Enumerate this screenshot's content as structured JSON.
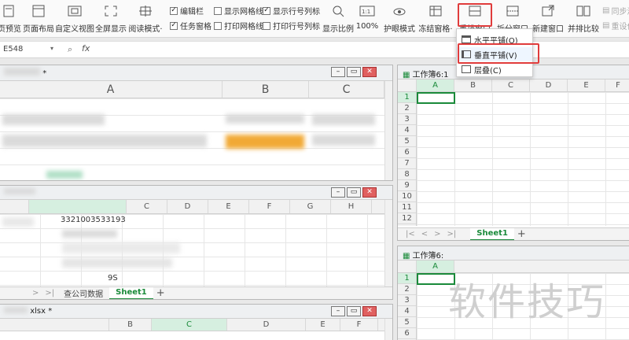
{
  "ribbon": {
    "buttons": [
      {
        "label": "页预览",
        "icon": "page-preview-icon"
      },
      {
        "label": "页面布局",
        "icon": "page-layout-icon"
      },
      {
        "label": "自定义视图",
        "icon": "custom-view-icon"
      },
      {
        "label": "全屏显示",
        "icon": "fullscreen-icon"
      },
      {
        "label": "阅读模式·",
        "icon": "reading-mode-icon"
      },
      {
        "label": "显示比例",
        "icon": "zoom-icon"
      },
      {
        "label": "100%",
        "icon": "zoom-100-icon"
      },
      {
        "label": "护眼模式",
        "icon": "eye-icon"
      },
      {
        "label": "冻结窗格·",
        "icon": "freeze-panes-icon"
      },
      {
        "label": "重排窗口",
        "icon": "arrange-windows-icon"
      },
      {
        "label": "拆分窗口",
        "icon": "split-window-icon"
      },
      {
        "label": "新建窗口",
        "icon": "new-window-icon"
      },
      {
        "label": "并排比较",
        "icon": "side-by-side-icon"
      }
    ],
    "checks": [
      {
        "label": "编辑栏",
        "checked": true
      },
      {
        "label": "任务窗格",
        "checked": true
      },
      {
        "label": "显示网格线",
        "checked": false
      },
      {
        "label": "打印网格线",
        "checked": false
      },
      {
        "label": "显示行号列标",
        "checked": true
      },
      {
        "label": "打印行号列标",
        "checked": false
      }
    ],
    "right_labels": [
      "同步滚",
      "重设位"
    ]
  },
  "formula_bar": {
    "name_box": "E548",
    "fx": "fx"
  },
  "dropdown": {
    "items": [
      "水平平铺(O)",
      "垂直平铺(V)",
      "层叠(C)"
    ]
  },
  "win_main": {
    "title": "",
    "title_suffix": "*",
    "columns": [
      "A",
      "B",
      "C"
    ]
  },
  "win_2": {
    "columns": [
      "C",
      "D",
      "E",
      "F",
      "G",
      "H"
    ],
    "cell_value": "3321003533193",
    "cell_suffix": "9S",
    "tabs": [
      "查公司数据",
      "Sheet1"
    ]
  },
  "win_3": {
    "title": "xlsx *",
    "columns": [
      "B",
      "C",
      "D",
      "E",
      "F"
    ]
  },
  "win_right1": {
    "title": "工作簿6:1",
    "columns": [
      "A",
      "B",
      "C",
      "D",
      "E",
      "F"
    ],
    "rows": [
      "1",
      "2",
      "3",
      "4",
      "5",
      "6",
      "7",
      "8",
      "9",
      "10",
      "11",
      "12"
    ],
    "tabs": [
      "Sheet1"
    ]
  },
  "win_right2": {
    "title": "工作簿6:",
    "columns": [
      "A"
    ],
    "rows": [
      "1",
      "2",
      "3",
      "4",
      "5",
      "6"
    ]
  },
  "watermark": "软件技巧",
  "colors": {
    "accent_green": "#1a8a3a",
    "highlight_red": "#e03c3c"
  }
}
